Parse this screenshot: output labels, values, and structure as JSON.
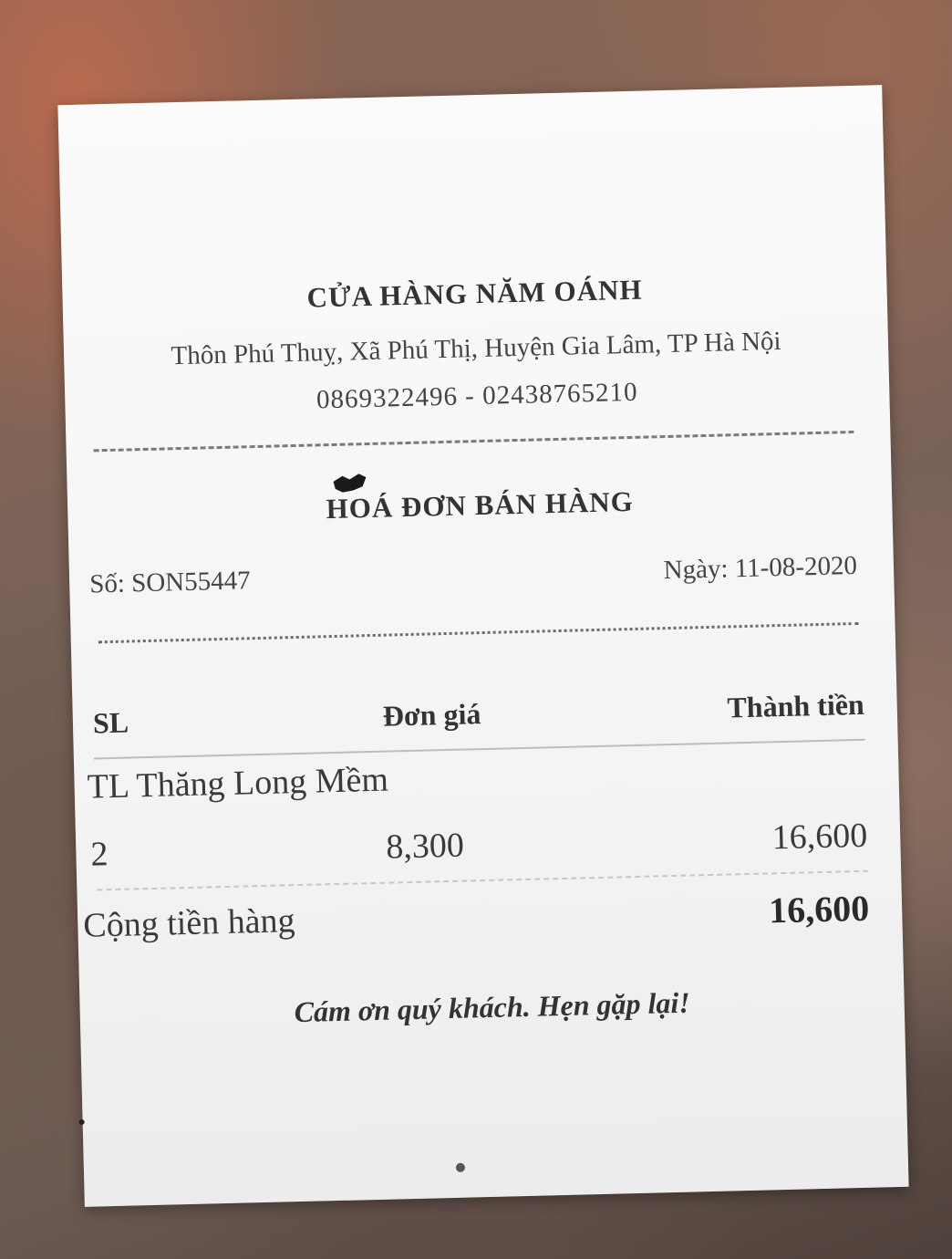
{
  "store": {
    "name": "CỬA HÀNG NĂM OÁNH",
    "address": "Thôn Phú Thuỵ, Xã Phú Thị, Huyện Gia Lâm, TP Hà Nội",
    "phone": "0869322496 - 02438765210"
  },
  "invoice": {
    "title": "HOÁ ĐƠN BÁN HÀNG",
    "number": "Số: SON55447",
    "date": "Ngày: 11-08-2020"
  },
  "table": {
    "headers": {
      "qty": "SL",
      "unit_price": "Đơn giá",
      "amount": "Thành tiền"
    },
    "items": [
      {
        "name": "TL Thăng Long Mềm",
        "qty": "2",
        "unit_price": "8,300",
        "amount": "16,600"
      }
    ]
  },
  "summary": {
    "subtotal_label": "Cộng tiền hàng",
    "subtotal_value": "16,600"
  },
  "footer": {
    "thanks": "Cám ơn quý khách. Hẹn gặp lại!"
  },
  "colors": {
    "paper": "#f7f7f7",
    "ink": "#333333",
    "background": "#7a6358"
  }
}
